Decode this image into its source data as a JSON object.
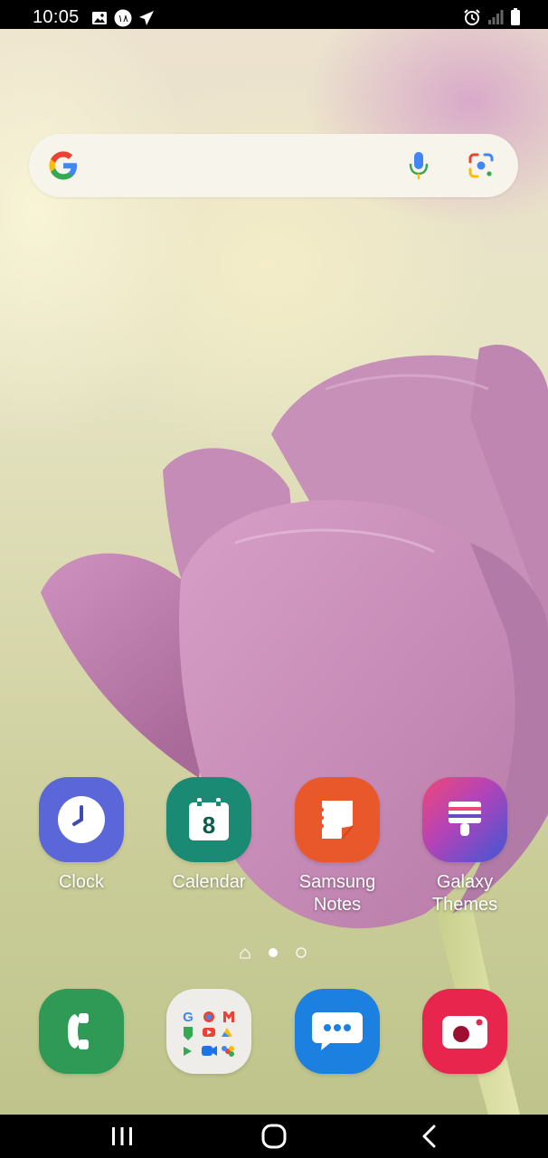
{
  "status_bar": {
    "time": "10:05",
    "left_icons": [
      "image-icon",
      "notification-badge-icon",
      "telegram-icon"
    ],
    "right_icons": [
      "alarm-icon",
      "signal-icon",
      "battery-icon"
    ]
  },
  "search_widget": {
    "logo": "google-logo-icon",
    "voice_icon": "microphone-icon",
    "lens_icon": "google-lens-icon"
  },
  "home_apps": [
    {
      "label": "Clock",
      "icon": "clock-icon",
      "color": "#5b67d8"
    },
    {
      "label": "Calendar",
      "icon": "calendar-icon",
      "color": "#1a8a74",
      "day": "8"
    },
    {
      "label": "Samsung Notes",
      "label_line1": "Samsung",
      "label_line2": "Notes",
      "icon": "notes-icon",
      "color": "#e8582b"
    },
    {
      "label": "Galaxy Themes",
      "label_line1": "Galaxy",
      "label_line2": "Themes",
      "icon": "themes-brush-icon",
      "color": "#6a4cc7"
    }
  ],
  "page_indicator": {
    "pages": 2,
    "current_page": 1,
    "has_home_marker": true
  },
  "dock": [
    {
      "name": "Phone",
      "icon": "phone-icon",
      "color": "#2f9a55"
    },
    {
      "name": "Google folder",
      "icon": "google-apps-folder-icon",
      "color": "#efedea"
    },
    {
      "name": "Messages",
      "icon": "messages-icon",
      "color": "#1b80e0"
    },
    {
      "name": "Screen recorder",
      "icon": "camera-icon",
      "color": "#e8264d"
    }
  ],
  "nav_bar": {
    "recents": "recents-icon",
    "home": "home-icon",
    "back": "back-icon"
  }
}
